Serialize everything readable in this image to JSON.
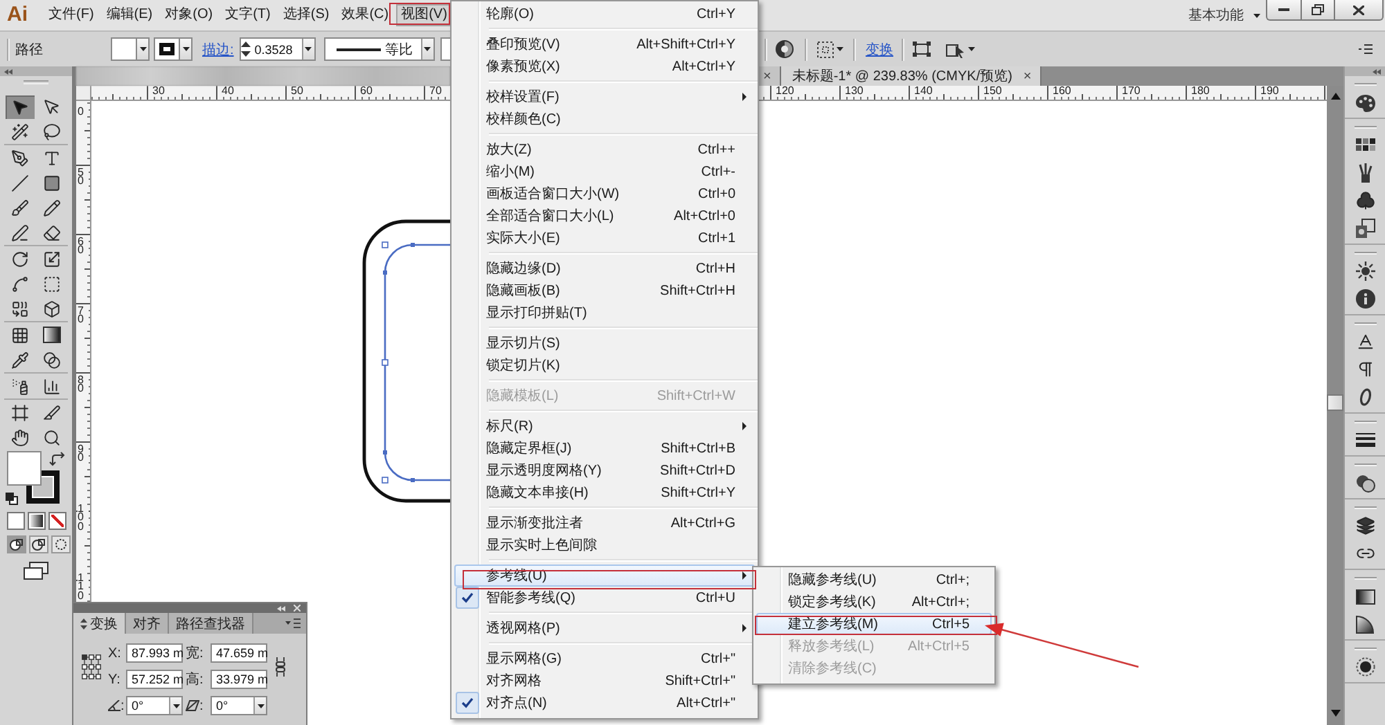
{
  "menubar": {
    "logo": "Ai",
    "items": [
      {
        "label": "文件(F)",
        "selected": false
      },
      {
        "label": "编辑(E)",
        "selected": false
      },
      {
        "label": "对象(O)",
        "selected": false
      },
      {
        "label": "文字(T)",
        "selected": false
      },
      {
        "label": "选择(S)",
        "selected": false
      },
      {
        "label": "效果(C)",
        "selected": false
      },
      {
        "label": "视图(V)",
        "selected": true
      }
    ],
    "workspace": "基本功能"
  },
  "control_bar": {
    "selection": "路径",
    "stroke_link": "描边:",
    "stroke_weight": "0.3528",
    "stroke_profile": "等比",
    "transform_link": "变换"
  },
  "toolbox": {
    "tools": [
      {
        "selected": true
      },
      {
        "selected": false
      },
      {
        "selected": false
      },
      {
        "selected": false
      },
      {
        "selected": false
      },
      {
        "selected": false
      },
      {
        "selected": false
      },
      {
        "selected": false
      },
      {
        "selected": false
      },
      {
        "selected": false
      },
      {
        "selected": false
      },
      {
        "selected": false
      },
      {
        "selected": false
      },
      {
        "selected": false
      },
      {
        "selected": false
      },
      {
        "selected": false
      },
      {
        "selected": false
      },
      {
        "selected": false
      },
      {
        "selected": false
      },
      {
        "selected": false
      },
      {
        "selected": false
      },
      {
        "selected": false
      },
      {
        "selected": false
      },
      {
        "selected": false
      },
      {
        "selected": false
      },
      {
        "selected": false
      },
      {
        "selected": false
      },
      {
        "selected": false
      }
    ]
  },
  "document": {
    "tabs": [
      {
        "close": "×",
        "selected": false
      },
      {
        "title": "未标题-1* @ 239.83% (CMYK/预览)",
        "close": "×",
        "selected": true
      }
    ],
    "rulers": {
      "horizontal": [
        {
          "labels": [
            "30",
            "40",
            "50",
            "60",
            "70"
          ]
        },
        {
          "labels": [
            "120",
            "130",
            "140",
            "150",
            "160",
            "170",
            "180",
            "190"
          ]
        }
      ],
      "vertical": [
        "0",
        "50",
        "60",
        "70",
        "80",
        "90",
        "100",
        "110"
      ]
    }
  },
  "view_menu": {
    "groups": [
      {
        "items": [
          {
            "label": "轮廓(O)",
            "shortcut": "Ctrl+Y",
            "submenu": false,
            "checked": false,
            "disabled": false,
            "selected": false
          }
        ]
      },
      {
        "items": [
          {
            "label": "叠印预览(V)",
            "shortcut": "Alt+Shift+Ctrl+Y",
            "submenu": false,
            "checked": false,
            "disabled": false,
            "selected": false
          },
          {
            "label": "像素预览(X)",
            "shortcut": "Alt+Ctrl+Y",
            "submenu": false,
            "checked": false,
            "disabled": false,
            "selected": false
          }
        ]
      },
      {
        "items": [
          {
            "label": "校样设置(F)",
            "submenu": true,
            "checked": false,
            "disabled": false,
            "selected": false
          },
          {
            "label": "校样颜色(C)",
            "submenu": false,
            "checked": false,
            "disabled": false,
            "selected": false
          }
        ]
      },
      {
        "items": [
          {
            "label": "放大(Z)",
            "shortcut": "Ctrl++",
            "submenu": false,
            "checked": false,
            "disabled": false,
            "selected": false
          },
          {
            "label": "缩小(M)",
            "shortcut": "Ctrl+-",
            "submenu": false,
            "checked": false,
            "disabled": false,
            "selected": false
          },
          {
            "label": "画板适合窗口大小(W)",
            "shortcut": "Ctrl+0",
            "submenu": false,
            "checked": false,
            "disabled": false,
            "selected": false
          },
          {
            "label": "全部适合窗口大小(L)",
            "shortcut": "Alt+Ctrl+0",
            "submenu": false,
            "checked": false,
            "disabled": false,
            "selected": false
          },
          {
            "label": "实际大小(E)",
            "shortcut": "Ctrl+1",
            "submenu": false,
            "checked": false,
            "disabled": false,
            "selected": false
          }
        ]
      },
      {
        "items": [
          {
            "label": "隐藏边缘(D)",
            "shortcut": "Ctrl+H",
            "submenu": false,
            "checked": false,
            "disabled": false,
            "selected": false
          },
          {
            "label": "隐藏画板(B)",
            "shortcut": "Shift+Ctrl+H",
            "submenu": false,
            "checked": false,
            "disabled": false,
            "selected": false
          },
          {
            "label": "显示打印拼贴(T)",
            "submenu": false,
            "checked": false,
            "disabled": false,
            "selected": false
          }
        ]
      },
      {
        "items": [
          {
            "label": "显示切片(S)",
            "submenu": false,
            "checked": false,
            "disabled": false,
            "selected": false
          },
          {
            "label": "锁定切片(K)",
            "submenu": false,
            "checked": false,
            "disabled": false,
            "selected": false
          }
        ]
      },
      {
        "items": [
          {
            "label": "隐藏模板(L)",
            "shortcut": "Shift+Ctrl+W",
            "submenu": false,
            "checked": false,
            "disabled": true,
            "selected": false
          }
        ]
      },
      {
        "items": [
          {
            "label": "标尺(R)",
            "submenu": true,
            "checked": false,
            "disabled": false,
            "selected": false
          },
          {
            "label": "隐藏定界框(J)",
            "shortcut": "Shift+Ctrl+B",
            "submenu": false,
            "checked": false,
            "disabled": false,
            "selected": false
          },
          {
            "label": "显示透明度网格(Y)",
            "shortcut": "Shift+Ctrl+D",
            "submenu": false,
            "checked": false,
            "disabled": false,
            "selected": false
          },
          {
            "label": "隐藏文本串接(H)",
            "shortcut": "Shift+Ctrl+Y",
            "submenu": false,
            "checked": false,
            "disabled": false,
            "selected": false
          }
        ]
      },
      {
        "items": [
          {
            "label": "显示渐变批注者",
            "shortcut": "Alt+Ctrl+G",
            "submenu": false,
            "checked": false,
            "disabled": false,
            "selected": false
          },
          {
            "label": "显示实时上色间隙",
            "submenu": false,
            "checked": false,
            "disabled": false,
            "selected": false
          }
        ]
      },
      {
        "items": [
          {
            "label": "参考线(U)",
            "submenu": true,
            "checked": false,
            "disabled": false,
            "selected": true
          },
          {
            "label": "智能参考线(Q)",
            "shortcut": "Ctrl+U",
            "submenu": false,
            "checked": true,
            "disabled": false,
            "selected": false
          }
        ]
      },
      {
        "items": [
          {
            "label": "透视网格(P)",
            "submenu": true,
            "checked": false,
            "disabled": false,
            "selected": false
          }
        ]
      },
      {
        "items": [
          {
            "label": "显示网格(G)",
            "shortcut": "Ctrl+\"",
            "submenu": false,
            "checked": false,
            "disabled": false,
            "selected": false
          },
          {
            "label": "对齐网格",
            "shortcut": "Shift+Ctrl+\"",
            "submenu": false,
            "checked": false,
            "disabled": false,
            "selected": false
          },
          {
            "label": "对齐点(N)",
            "shortcut": "Alt+Ctrl+\"",
            "submenu": false,
            "checked": true,
            "disabled": false,
            "selected": false
          }
        ]
      }
    ]
  },
  "guides_submenu": {
    "items": [
      {
        "label": "隐藏参考线(U)",
        "shortcut": "Ctrl+;",
        "disabled": false,
        "selected": false
      },
      {
        "label": "锁定参考线(K)",
        "shortcut": "Alt+Ctrl+;",
        "disabled": false,
        "selected": false
      },
      {
        "label": "建立参考线(M)",
        "shortcut": "Ctrl+5",
        "disabled": false,
        "selected": true
      },
      {
        "label": "释放参考线(L)",
        "shortcut": "Alt+Ctrl+5",
        "disabled": true,
        "selected": false
      },
      {
        "label": "清除参考线(C)",
        "disabled": true,
        "selected": false
      }
    ]
  },
  "transform_panel": {
    "tabs": [
      {
        "label": "变换",
        "selected": true
      },
      {
        "label": "对齐",
        "selected": false
      },
      {
        "label": "路径查找器",
        "selected": false
      }
    ],
    "x": {
      "label": "X:",
      "value": "87.993 m"
    },
    "width": {
      "label": "宽:",
      "value": "47.659 m"
    },
    "y": {
      "label": "Y:",
      "value": "57.252 m"
    },
    "height": {
      "label": "高:",
      "value": "33.979 m"
    },
    "rotate": {
      "label": ":",
      "value": "0°"
    },
    "shear": {
      "label": ":",
      "value": "0°"
    }
  }
}
